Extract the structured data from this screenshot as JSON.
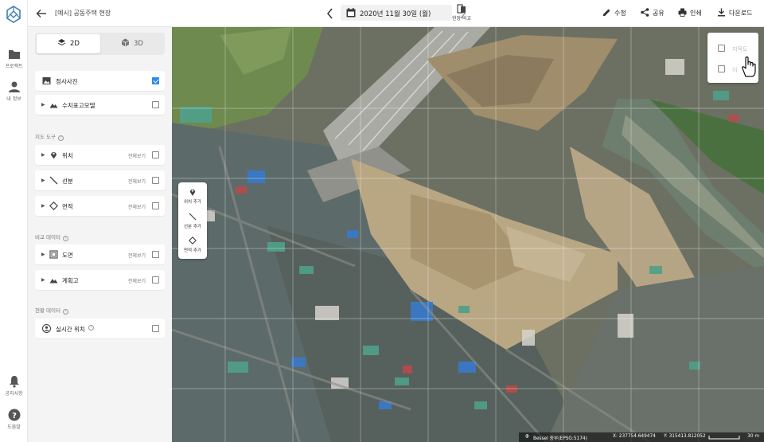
{
  "rail": {
    "items": [
      {
        "label": "프로젝트",
        "icon": "folder-icon"
      },
      {
        "label": "내 정보",
        "icon": "user-icon"
      },
      {
        "label": "공지사항",
        "icon": "bell-icon"
      },
      {
        "label": "도움말",
        "icon": "help-icon"
      }
    ]
  },
  "header": {
    "title": "[예시] 공동주택 현장",
    "date": "2020년 11월 30일 (월)",
    "compare_label": "현장 비교",
    "actions": [
      {
        "label": "수정",
        "icon": "pencil-icon"
      },
      {
        "label": "공유",
        "icon": "share-icon"
      },
      {
        "label": "인쇄",
        "icon": "printer-icon"
      },
      {
        "label": "다운로드",
        "icon": "download-icon"
      }
    ]
  },
  "panel": {
    "view_tabs": [
      {
        "label": "2D",
        "active": true
      },
      {
        "label": "3D",
        "active": false
      }
    ],
    "base_layers": [
      {
        "label": "정사사진",
        "checked": true
      },
      {
        "label": "수치표고모델",
        "checked": false
      }
    ],
    "map_tools": {
      "title": "지도 도구",
      "items": [
        {
          "label": "위치",
          "all_label": "전체보기",
          "checked": false
        },
        {
          "label": "선분",
          "all_label": "전체보기",
          "checked": false
        },
        {
          "label": "면적",
          "all_label": "전체보기",
          "checked": false
        }
      ]
    },
    "compare_data": {
      "title": "비교 데이터",
      "items": [
        {
          "label": "도면",
          "all_label": "전체보기",
          "checked": false
        },
        {
          "label": "계획고",
          "all_label": "전체보기",
          "checked": false
        }
      ]
    },
    "site_data": {
      "title": "현황 데이터",
      "items": [
        {
          "label": "실시간 위치",
          "checked": false
        }
      ]
    }
  },
  "map": {
    "draw_tools": [
      {
        "label": "위치 추가"
      },
      {
        "label": "선분 추가"
      },
      {
        "label": "면적 추가"
      }
    ],
    "basemap_options": [
      {
        "label": "지적도",
        "checked": false
      },
      {
        "label": "이",
        "checked": false
      }
    ],
    "status": {
      "crs": "Bessel 중부(EPSG:5174)",
      "x": "X: 237754.649474",
      "y": "Y: 315413.812052",
      "scale": "30 m"
    }
  },
  "colors": {
    "accent": "#2d8ae8",
    "logo": "#3f7fb5"
  }
}
